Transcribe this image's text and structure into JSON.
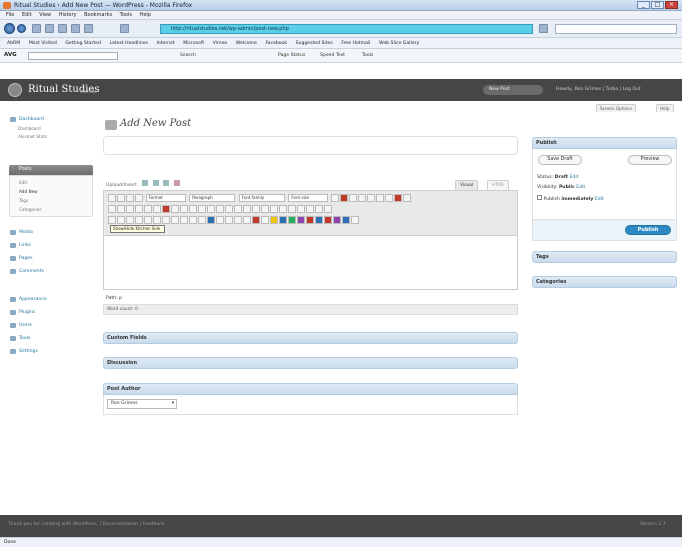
{
  "window": {
    "title": "Ritual Studies › Add New Post — WordPress - Mozilla Firefox"
  },
  "menu": [
    "File",
    "Edit",
    "View",
    "History",
    "Bookmarks",
    "Tools",
    "Help"
  ],
  "url": "http://ritualstudies.net/wp-admin/post-new.php",
  "bookmarks": [
    "AbRM",
    "Most Visited",
    "Getting Started",
    "Latest Headlines",
    "Internet",
    "Microsoft",
    "Vimeo",
    "Welcome",
    "Facebook",
    "Suggested Sites",
    "Free Hotmail",
    "Web Slice Gallery"
  ],
  "search_toolbar": {
    "logo": "AVG",
    "search_label": "Search",
    "items": [
      "Search",
      "Page Status",
      "Speed Test",
      "Tools"
    ]
  },
  "wp_header": {
    "site_title": "Ritual Studies",
    "visit_site": "Visit site",
    "favorite_action": "New Post",
    "howdy": "Howdy, Ron Grimes | Turbo | Log Out"
  },
  "screen_tabs": [
    "Screen Options",
    "Help"
  ],
  "sidebar": {
    "dashboard": "Dashboard",
    "dashboard_sub": [
      "Dashboard",
      "Akismet Stats"
    ],
    "posts": "Posts",
    "posts_sub": [
      "Edit",
      "Add New",
      "Tags",
      "Categories"
    ],
    "menu": [
      "Media",
      "Links",
      "Pages",
      "Comments"
    ],
    "menu2": [
      "Appearance",
      "Plugins",
      "Users",
      "Tools",
      "Settings"
    ]
  },
  "page_title": "Add New Post",
  "editor": {
    "upload_insert": "Upload/Insert",
    "tab_visual": "Visual",
    "tab_html": "HTML",
    "format_select": "Format",
    "paragraph_select": "Paragraph",
    "font_family_select": "Font family",
    "font_size_select": "Font size",
    "tooltip": "Show/Hide Kitchen Sink",
    "path": "Path: p",
    "word_count": "Word count: 0"
  },
  "boxes": {
    "custom_fields": "Custom Fields",
    "discussion": "Discussion",
    "post_author": "Post Author",
    "author_value": "Ron Grimes"
  },
  "publish": {
    "title": "Publish",
    "save_draft": "Save Draft",
    "preview": "Preview",
    "status_label": "Status:",
    "status_value": "Draft",
    "visibility_label": "Visibility:",
    "visibility_value": "Public",
    "publish_label": "Publish",
    "publish_when": "immediately",
    "edit": "Edit",
    "publish_button": "Publish"
  },
  "tags_title": "Tags",
  "categories_title": "Categories",
  "footer": {
    "thanks": "Thank you for creating with WordPress. | Documentation | Feedback",
    "version": "Version 2.7"
  },
  "statusbar": "Done"
}
